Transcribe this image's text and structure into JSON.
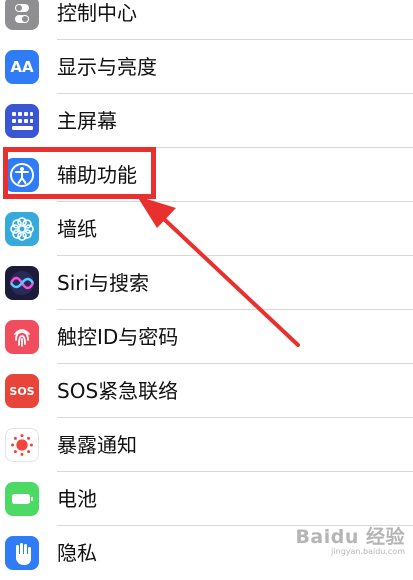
{
  "settings_list": {
    "items": [
      {
        "label": "控制中心",
        "icon": "control-center-icon",
        "color": "#8e8e93"
      },
      {
        "label": "显示与亮度",
        "icon": "display-brightness-icon",
        "color": "#2f7cf6",
        "icon_text": "AA"
      },
      {
        "label": "主屏幕",
        "icon": "home-screen-icon",
        "color": "#3a56d4"
      },
      {
        "label": "辅助功能",
        "icon": "accessibility-icon",
        "color": "#2f7cf6"
      },
      {
        "label": "墙纸",
        "icon": "wallpaper-icon",
        "color": "#36aadc"
      },
      {
        "label": "Siri与搜索",
        "icon": "siri-icon",
        "color": "#1c1c3a"
      },
      {
        "label": "触控ID与密码",
        "icon": "touch-id-icon",
        "color": "#f24d5e"
      },
      {
        "label": "SOS紧急联络",
        "icon": "sos-icon",
        "color": "#e8443a",
        "icon_text": "SOS"
      },
      {
        "label": "暴露通知",
        "icon": "exposure-notification-icon",
        "color": "#ffffff"
      },
      {
        "label": "电池",
        "icon": "battery-icon",
        "color": "#4cd964"
      },
      {
        "label": "隐私",
        "icon": "privacy-hand-icon",
        "color": "#2f7cf6"
      }
    ]
  },
  "annotation": {
    "color": "#e8312f"
  },
  "watermark": {
    "logo": "Baidu 经验",
    "url": "jingyan.baidu.com"
  }
}
